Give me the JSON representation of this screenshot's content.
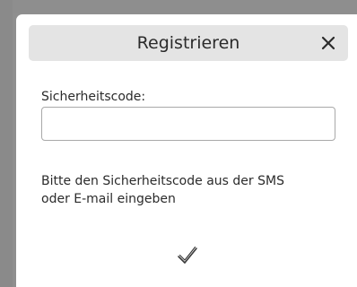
{
  "dialog": {
    "title": "Registrieren",
    "close_icon": "close-icon",
    "field_label": "Sicherheitscode:",
    "code_input": {
      "value": "",
      "placeholder": ""
    },
    "hint_line_1": "Bitte den Sicherheitscode aus der SMS",
    "hint_line_2": "oder E-mail eingeben",
    "confirm_icon": "checkmark-icon"
  },
  "colors": {
    "backdrop": "#8f8f8f",
    "header_background": "#e4e4e4",
    "dialog_background": "#ffffff",
    "text": "#2b2b2b",
    "input_border": "#a9a9a9"
  }
}
